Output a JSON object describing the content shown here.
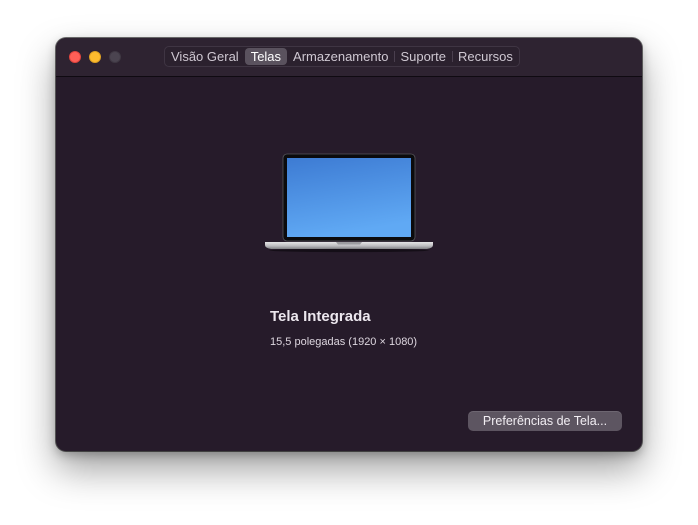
{
  "window": {
    "controls": [
      "close",
      "minimize",
      "zoom"
    ]
  },
  "tabs": [
    {
      "label": "Visão Geral",
      "selected": false
    },
    {
      "label": "Telas",
      "selected": true
    },
    {
      "label": "Armazenamento",
      "selected": false
    },
    {
      "label": "Suporte",
      "selected": false
    },
    {
      "label": "Recursos",
      "selected": false
    }
  ],
  "display": {
    "name": "Tela Integrada",
    "spec": "15,5 polegadas (1920 × 1080)"
  },
  "actions": {
    "preferences_label": "Preferências de Tela..."
  },
  "colors": {
    "window_bg": "#261b2a",
    "close": "#ff5f57",
    "minimize": "#febc2e",
    "zoom_inactive": "#4b4450",
    "screen_gradient_top": "#3f7fd6",
    "screen_gradient_bottom": "#5da6f2"
  },
  "icons": [
    "laptop-icon"
  ]
}
